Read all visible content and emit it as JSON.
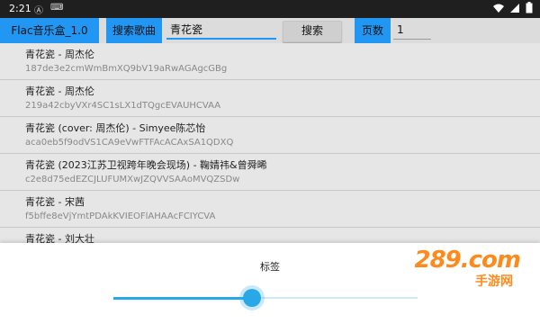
{
  "status_bar": {
    "time": "2:21",
    "icons": [
      "notification-a-icon",
      "keyboard-icon",
      "wifi-icon",
      "signal-icon",
      "battery-icon"
    ]
  },
  "toolbar": {
    "app_title": "Flac音乐盒_1.0",
    "search_label": "搜索歌曲",
    "search_value": "青花瓷",
    "search_button": "搜索",
    "page_label": "页数",
    "page_value": "1"
  },
  "songs": [
    {
      "title": "青花瓷 - 周杰伦",
      "id": "187de3e2cmWmBmXQ9bV19aRwAGAgcGBg"
    },
    {
      "title": "青花瓷 - 周杰伦",
      "id": "219a42cbyVXr4SC1sLX1dTQgcEVAUHCVAA"
    },
    {
      "title": "青花瓷 (cover: 周杰伦) - Simyee陈芯怡",
      "id": "aca0eb5f9odVS1CA9eVwFTFAcACAxSA1QDXQ"
    },
    {
      "title": "青花瓷 (2023江苏卫视跨年晚会现场) - 鞠婧祎&曾舜晞",
      "id": "c2e8d75edEZCJLUFUMXwJZQVVSAAoMVQZSDw"
    },
    {
      "title": "青花瓷 - 宋茜",
      "id": "f5bffe8eVjYmtPDAkKVIEOFlAHAAcFCIYCVA"
    },
    {
      "title": "青花瓷 - 刘大壮",
      "id": ""
    }
  ],
  "bottom_sheet": {
    "label": "标签",
    "slider_fraction": 0.45
  },
  "watermark": {
    "brand": "289.com",
    "sub": "手游网"
  },
  "colors": {
    "accent": "#2196f3",
    "slider": "#29a8e8",
    "watermark": "#ff8a1c"
  }
}
